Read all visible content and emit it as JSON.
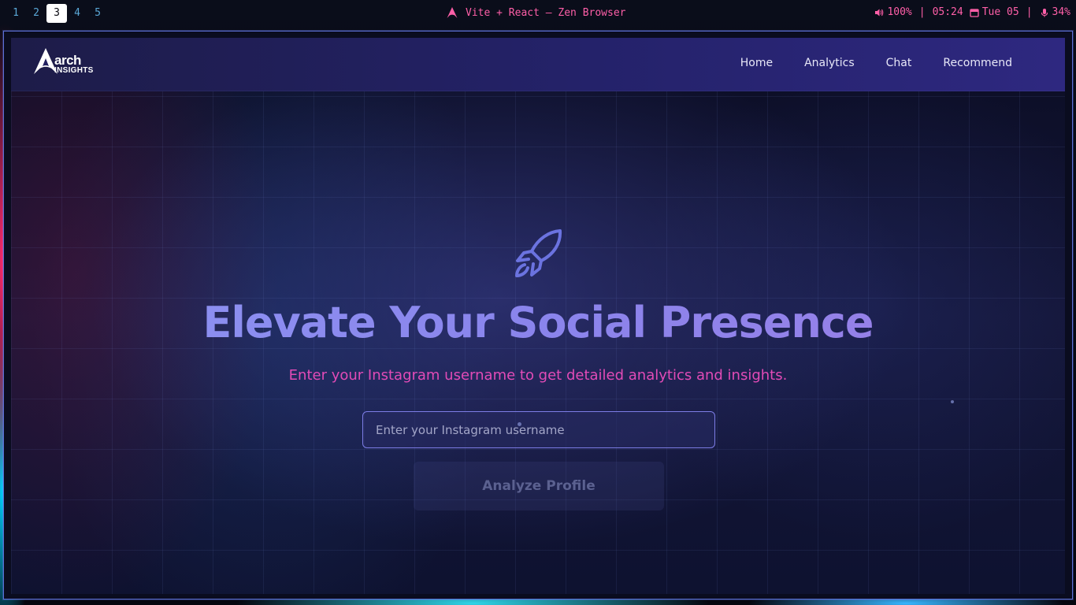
{
  "topbar": {
    "workspaces": [
      "1",
      "2",
      "3",
      "4",
      "5"
    ],
    "active_workspace": "3",
    "window_title": "Vite + React — Zen Browser",
    "volume": "100%",
    "time": "05:24",
    "date": "Tue 05",
    "mic": "34%",
    "separator": "|",
    "accent_color": "#ff5fa8"
  },
  "navbar": {
    "logo_word": "arch",
    "logo_sub": "INSIGHTS",
    "links": [
      "Home",
      "Analytics",
      "Chat",
      "Recommend"
    ]
  },
  "hero": {
    "icon": "rocket-icon",
    "title": "Elevate Your Social Presence",
    "subtitle": "Enter your Instagram username to get detailed analytics and insights.",
    "input_placeholder": "Enter your Instagram username",
    "input_value": "",
    "button_label": "Analyze Profile"
  },
  "colors": {
    "title": "#8c89f0",
    "subtitle": "#e24bb7",
    "input_border": "#7d7de6",
    "nav_bg": "#24226a"
  }
}
